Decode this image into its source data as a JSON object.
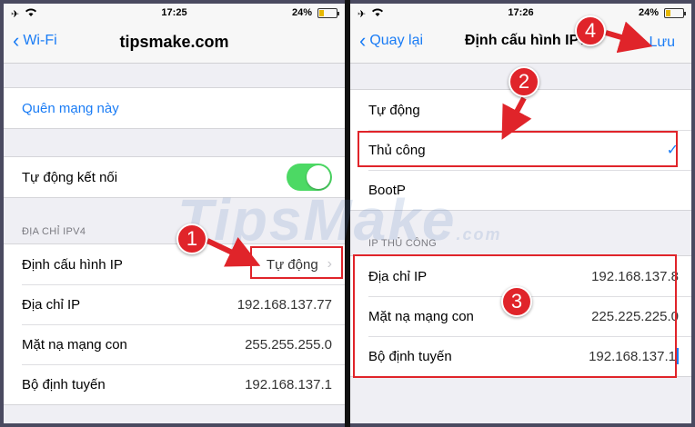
{
  "left": {
    "status": {
      "time": "17:25",
      "battery": "24%",
      "battery_level": 0.24
    },
    "nav": {
      "back_label": "Wi-Fi",
      "title": "tipsmake.com"
    },
    "forget_label": "Quên mạng này",
    "auto_join_label": "Tự động kết nối",
    "auto_join_on": true,
    "section_header": "ĐỊA CHỈ IPV4",
    "rows": [
      {
        "label": "Định cấu hình IP",
        "value": "Tự động"
      },
      {
        "label": "Địa chỉ IP",
        "value": "192.168.137.77"
      },
      {
        "label": "Mặt nạ mạng con",
        "value": "255.255.255.0"
      },
      {
        "label": "Bộ định tuyến",
        "value": "192.168.137.1"
      }
    ]
  },
  "right": {
    "status": {
      "time": "17:26",
      "battery": "24%",
      "battery_level": 0.24
    },
    "nav": {
      "back_label": "Quay lại",
      "title": "Định cấu hình IPv4",
      "action_label": "Lưu"
    },
    "options": [
      "Tự động",
      "Thủ công",
      "BootP"
    ],
    "selected_option": "Thủ công",
    "section_header": "IP THỦ CÔNG",
    "rows": [
      {
        "label": "Địa chỉ IP",
        "value": "192.168.137.8"
      },
      {
        "label": "Mặt nạ mạng con",
        "value": "225.225.225.0"
      },
      {
        "label": "Bộ định tuyến",
        "value": "192.168.137.1"
      }
    ]
  },
  "annotations": {
    "step1": "1",
    "step2": "2",
    "step3": "3",
    "step4": "4"
  },
  "watermark": {
    "main": "TipsMake",
    "suffix": ".com"
  },
  "colors": {
    "accent": "#1a7cf5",
    "toggle_on": "#4cd964",
    "highlight": "#e0242a"
  }
}
